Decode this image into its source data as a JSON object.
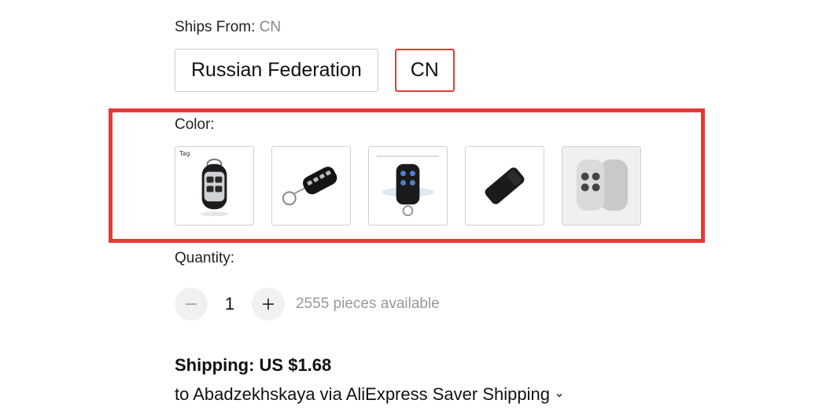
{
  "ships_from": {
    "label": "Ships From:",
    "selected_value": "CN",
    "options": [
      {
        "label": "Russian Federation",
        "selected": false
      },
      {
        "label": "CN",
        "selected": true
      }
    ]
  },
  "color": {
    "label": "Color:",
    "swatches": [
      {
        "icon": "silver-remote-key-image",
        "tag": "Tag",
        "selected": false
      },
      {
        "icon": "black-flip-key-remote-image",
        "selected": false
      },
      {
        "icon": "black-blue-button-remote-image",
        "selected": false
      },
      {
        "icon": "black-slim-remote-image",
        "selected": false
      },
      {
        "icon": "grey-double-remote-image",
        "selected": false
      }
    ],
    "highlight_color": "#e53935"
  },
  "quantity": {
    "label": "Quantity:",
    "value": "1",
    "available": "2555 pieces available"
  },
  "shipping": {
    "cost": "Shipping: US $1.68",
    "destination": "to Abadzekhskaya via AliExpress Saver Shipping"
  },
  "colors": {
    "accent": "#e53935",
    "border": "#cccccc",
    "muted_text": "#999999"
  }
}
